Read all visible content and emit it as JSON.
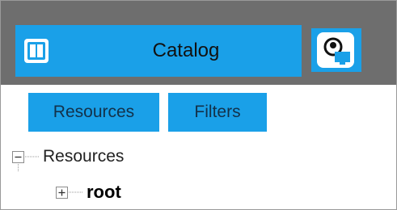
{
  "header": {
    "title": "Catalog",
    "panel_icon": "panel-toggle-icon",
    "user_icon": "user-monitor-icon",
    "colors": {
      "header_bg": "#6e6e6e",
      "accent": "#1aa0e8"
    }
  },
  "tabs": [
    {
      "label": "Resources"
    },
    {
      "label": "Filters"
    }
  ],
  "tree": {
    "root_node": {
      "label": "Resources",
      "state": "expanded"
    },
    "children": [
      {
        "label": "root",
        "state": "collapsed"
      }
    ]
  }
}
